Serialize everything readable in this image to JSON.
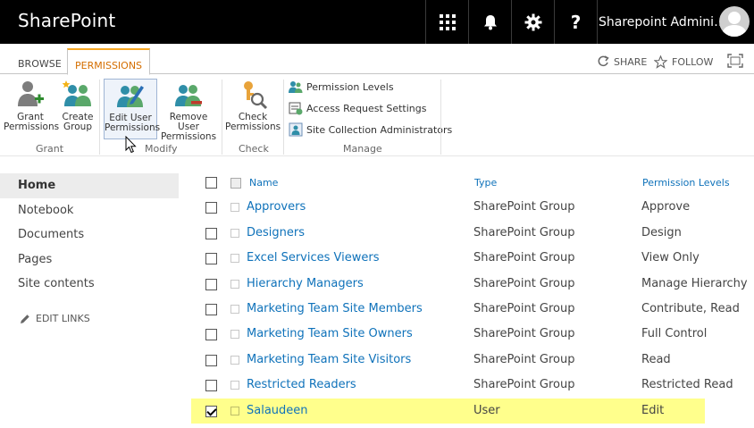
{
  "suite": {
    "brand": "SharePoint",
    "user_name": "Sharepoint Admini…",
    "icons": [
      "app-launcher-icon",
      "bell-icon",
      "gear-icon",
      "help-icon"
    ]
  },
  "ribbon": {
    "tabs": [
      {
        "label": "BROWSE",
        "active": false
      },
      {
        "label": "PERMISSIONS",
        "active": true
      }
    ],
    "share_label": "SHARE",
    "follow_label": "FOLLOW",
    "groups": {
      "grant": {
        "label": "Grant",
        "buttons": [
          {
            "line1": "Grant",
            "line2": "Permissions"
          },
          {
            "line1": "Create",
            "line2": "Group"
          }
        ]
      },
      "modify": {
        "label": "Modify",
        "buttons": [
          {
            "line1": "Edit User",
            "line2": "Permissions"
          },
          {
            "line1": "Remove User",
            "line2": "Permissions"
          }
        ]
      },
      "check": {
        "label": "Check",
        "buttons": [
          {
            "line1": "Check",
            "line2": "Permissions"
          }
        ]
      },
      "manage": {
        "label": "Manage",
        "items": [
          {
            "label": "Permission Levels"
          },
          {
            "label": "Access Request Settings"
          },
          {
            "label": "Site Collection Administrators"
          }
        ]
      }
    }
  },
  "nav": {
    "items": [
      {
        "label": "Home",
        "active": true
      },
      {
        "label": "Notebook",
        "active": false
      },
      {
        "label": "Documents",
        "active": false
      },
      {
        "label": "Pages",
        "active": false
      },
      {
        "label": "Site contents",
        "active": false
      }
    ],
    "edit_links": "EDIT LINKS"
  },
  "table": {
    "headers": {
      "name": "Name",
      "type": "Type",
      "levels": "Permission Levels"
    },
    "rows": [
      {
        "name": "Approvers",
        "type": "SharePoint Group",
        "levels": "Approve",
        "checked": false,
        "highlight": false
      },
      {
        "name": "Designers",
        "type": "SharePoint Group",
        "levels": "Design",
        "checked": false,
        "highlight": false
      },
      {
        "name": "Excel Services Viewers",
        "type": "SharePoint Group",
        "levels": "View Only",
        "checked": false,
        "highlight": false
      },
      {
        "name": "Hierarchy Managers",
        "type": "SharePoint Group",
        "levels": "Manage Hierarchy",
        "checked": false,
        "highlight": false
      },
      {
        "name": "Marketing Team Site Members",
        "type": "SharePoint Group",
        "levels": "Contribute, Read",
        "checked": false,
        "highlight": false
      },
      {
        "name": "Marketing Team Site Owners",
        "type": "SharePoint Group",
        "levels": "Full Control",
        "checked": false,
        "highlight": false
      },
      {
        "name": "Marketing Team Site Visitors",
        "type": "SharePoint Group",
        "levels": "Read",
        "checked": false,
        "highlight": false
      },
      {
        "name": "Restricted Readers",
        "type": "SharePoint Group",
        "levels": "Restricted Read",
        "checked": false,
        "highlight": false
      },
      {
        "name": "Salaudeen",
        "type": "User",
        "levels": "Edit",
        "checked": true,
        "highlight": true
      }
    ]
  },
  "colors": {
    "accent": "#d46e00",
    "link": "#0f72ba",
    "highlight": "#ffff8c",
    "suitebar": "#000000"
  }
}
